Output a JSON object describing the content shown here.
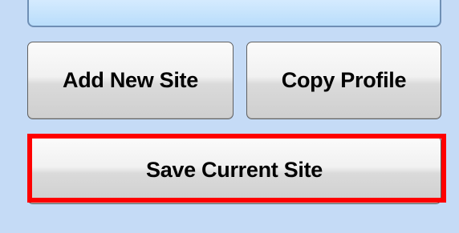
{
  "buttons": {
    "add_new_site": "Add New Site",
    "copy_profile": "Copy Profile",
    "save_current_site": "Save Current Site"
  },
  "colors": {
    "background": "#c5dbf6",
    "top_panel_fill": "#b9ddfb",
    "highlight": "#ff0000"
  }
}
